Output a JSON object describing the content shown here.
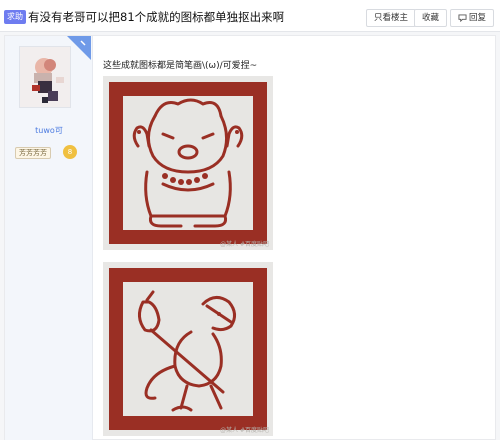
{
  "header": {
    "tag": "求助",
    "title": "有没有老哥可以把81个成就的图标都单独抠出来啊",
    "buttons": {
      "only_author": "只看楼主",
      "favorite": "收藏",
      "reply": "回复"
    }
  },
  "author": {
    "username": "tuwo可",
    "level_title": "芳芳芳芳",
    "level_number": "8"
  },
  "post": {
    "text": "这些成就图标都是简笔画\\(ω)/可爱捏~",
    "images": [
      {
        "subject": "bear-achievement-icon",
        "watermark": "@某人 #百度贴吧"
      },
      {
        "subject": "mouse-bindle-achievement-icon",
        "watermark": "@某人 #百度贴吧"
      }
    ]
  },
  "colors": {
    "brand_red": "#9a2f24",
    "tag_bg": "#6e7cf0",
    "page_bg": "#f5f6f8",
    "author_bg": "#f3f6fb",
    "badge_blue": "#6f9ae8"
  }
}
